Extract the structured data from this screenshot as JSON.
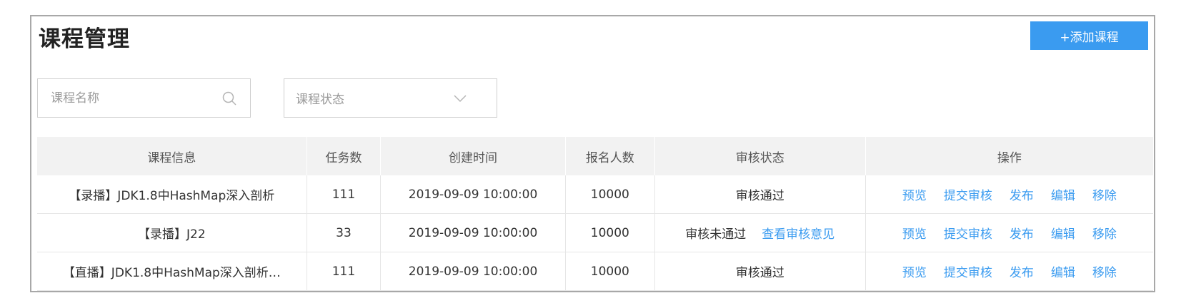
{
  "header": {
    "title": "课程管理",
    "add_button_label": "+添加课程"
  },
  "filters": {
    "search_placeholder": "课程名称",
    "status_placeholder": "课程状态"
  },
  "table": {
    "columns": [
      "课程信息",
      "任务数",
      "创建时间",
      "报名人数",
      "审核状态",
      "操作"
    ],
    "rows": [
      {
        "info": "【录播】JDK1.8中HashMap深入剖析",
        "tasks": "111",
        "created": "2019-09-09 10:00:00",
        "enrolled": "10000",
        "review_status": "审核通过",
        "review_link": ""
      },
      {
        "info": "【录播】J22",
        "tasks": "33",
        "created": "2019-09-09 10:00:00",
        "enrolled": "10000",
        "review_status": "审核未通过",
        "review_link": "查看审核意见"
      },
      {
        "info": "【直播】JDK1.8中HashMap深入剖析…",
        "tasks": "111",
        "created": "2019-09-09 10:00:00",
        "enrolled": "10000",
        "review_status": "审核通过",
        "review_link": ""
      }
    ],
    "actions": [
      "预览",
      "提交审核",
      "发布",
      "编辑",
      "移除"
    ]
  },
  "colors": {
    "accent": "#3a9bf0",
    "header_bg": "#f2f2f2"
  },
  "icons": {
    "search": "search-icon",
    "dropdown": "chevron-down-icon"
  }
}
